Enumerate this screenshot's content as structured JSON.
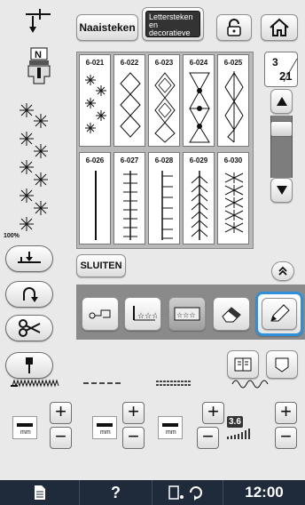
{
  "top": {
    "cat_tab_label": "Naaisteken",
    "cat_tab2_label": "Lettersteken en decoratieve steken"
  },
  "zoom": "100%",
  "stitches": [
    {
      "num": "6-021"
    },
    {
      "num": "6-022"
    },
    {
      "num": "6-023"
    },
    {
      "num": "6-024"
    },
    {
      "num": "6-025"
    },
    {
      "num": "6-026"
    },
    {
      "num": "6-027"
    },
    {
      "num": "6-028"
    },
    {
      "num": "6-029"
    },
    {
      "num": "6-030"
    }
  ],
  "page": {
    "current": "3",
    "total": "21"
  },
  "close_label": "SLUITEN",
  "adjust": {
    "length_value": "3.6",
    "width_unit": "mm",
    "length_unit": "mm",
    "tension_unit": "mm"
  },
  "status": {
    "help": "?",
    "time": "12:00"
  },
  "colors": {
    "highlight": "#2f8fd8",
    "statusbar": "#1f2a3a"
  }
}
